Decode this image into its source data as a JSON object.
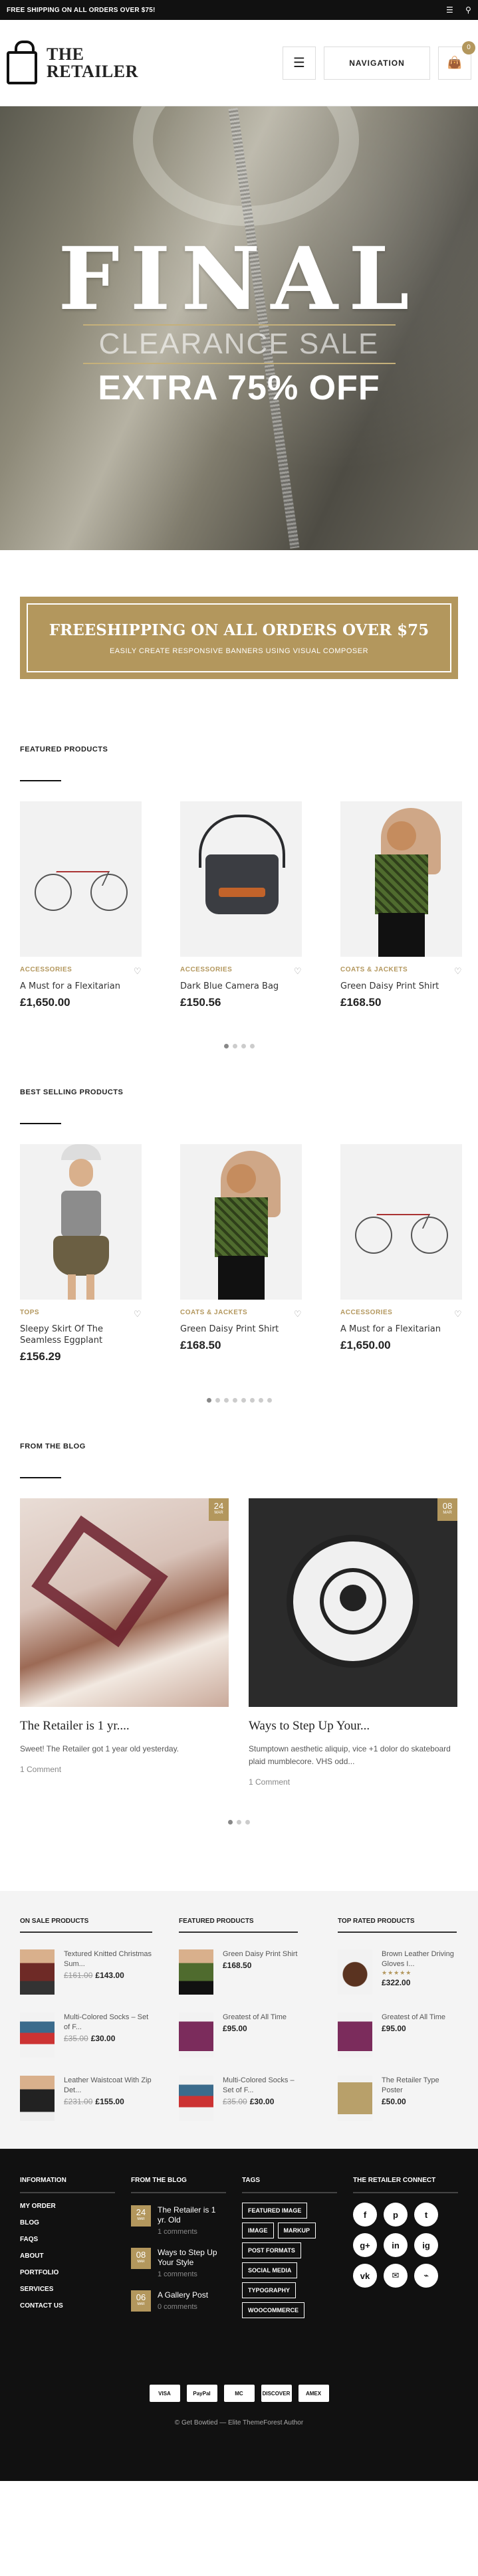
{
  "topbar": {
    "text": "FREE SHIPPING ON ALL ORDERS OVER $75!",
    "icons": [
      "menu-icon",
      "search-icon"
    ]
  },
  "header": {
    "logo_line1": "THE",
    "logo_line2": "RETAILER",
    "nav_label": "NAVIGATION",
    "cart_count": "0"
  },
  "hero": {
    "line1": "FINAL",
    "line2": "CLEARANCE SALE",
    "line3": "EXTRA 75% OFF"
  },
  "banner": {
    "title": "FREESHIPPING ON ALL ORDERS OVER $75",
    "subtitle": "EASILY CREATE RESPONSIVE BANNERS USING VISUAL COMPOSER"
  },
  "featured": {
    "title": "FEATURED PRODUCTS",
    "items": [
      {
        "category": "ACCESSORIES",
        "name": "A Must for a Flexitarian",
        "price": "£1,650.00"
      },
      {
        "category": "ACCESSORIES",
        "name": "Dark Blue Camera Bag",
        "price": "£150.56"
      },
      {
        "category": "COATS & JACKETS",
        "name": "Green Daisy Print Shirt",
        "price": "£168.50"
      }
    ]
  },
  "bestselling": {
    "title": "BEST SELLING PRODUCTS",
    "items": [
      {
        "category": "TOPS",
        "name": "Sleepy Skirt Of The Seamless Eggplant",
        "price": "£156.29"
      },
      {
        "category": "COATS & JACKETS",
        "name": "Green Daisy Print Shirt",
        "price": "£168.50"
      },
      {
        "category": "ACCESSORIES",
        "name": "A Must for a Flexitarian",
        "price": "£1,650.00"
      }
    ]
  },
  "blog": {
    "title": "FROM THE BLOG",
    "posts": [
      {
        "day": "24",
        "month": "MAR",
        "title": "The Retailer is 1 yr....",
        "excerpt": "Sweet! The Retailer got 1 year old yesterday.",
        "comments": "1 Comment"
      },
      {
        "day": "08",
        "month": "MAR",
        "title": "Ways to Step Up Your...",
        "excerpt": "Stumptown aesthetic aliquip, vice +1 dolor do skateboard plaid mumblecore. VHS odd...",
        "comments": "1 Comment"
      }
    ]
  },
  "lists": {
    "on_sale": {
      "title": "ON SALE PRODUCTS",
      "items": [
        {
          "name": "Textured Knitted Christmas Sum...",
          "old": "£161.00",
          "price": "£143.00"
        },
        {
          "name": "Multi-Colored Socks – Set of F...",
          "old": "£35.00",
          "price": "£30.00"
        },
        {
          "name": "Leather Waistcoat With Zip Det...",
          "old": "£231.00",
          "price": "£155.00"
        }
      ]
    },
    "featured": {
      "title": "FEATURED PRODUCTS",
      "items": [
        {
          "name": "Green Daisy Print Shirt",
          "old": "",
          "price": "£168.50"
        },
        {
          "name": "Greatest of All Time",
          "old": "",
          "price": "£95.00"
        },
        {
          "name": "Multi-Colored Socks – Set of F...",
          "old": "£35.00",
          "price": "£30.00"
        }
      ]
    },
    "top_rated": {
      "title": "TOP RATED PRODUCTS",
      "items": [
        {
          "name": "Brown Leather Driving Gloves I...",
          "old": "",
          "price": "£322.00",
          "rating": "★★★★★"
        },
        {
          "name": "Greatest of All Time",
          "old": "",
          "price": "£95.00"
        },
        {
          "name": "The Retailer Type Poster",
          "old": "",
          "price": "£50.00"
        }
      ]
    }
  },
  "footer": {
    "information": {
      "title": "INFORMATION",
      "links": [
        "MY ORDER",
        "BLOG",
        "FAQS",
        "ABOUT",
        "PORTFOLIO",
        "SERVICES",
        "CONTACT US"
      ]
    },
    "blog": {
      "title": "FROM THE BLOG",
      "posts": [
        {
          "day": "24",
          "month": "MAR",
          "title": "The Retailer is 1 yr. Old",
          "comments": "1 comments"
        },
        {
          "day": "08",
          "month": "MAR",
          "title": "Ways to Step Up Your Style",
          "comments": "1 comments"
        },
        {
          "day": "06",
          "month": "MAR",
          "title": "A Gallery Post",
          "comments": "0 comments"
        }
      ]
    },
    "tags": {
      "title": "TAGS",
      "items": [
        "FEATURED IMAGE",
        "IMAGE",
        "MARKUP",
        "POST FORMATS",
        "SOCIAL MEDIA",
        "TYPOGRAPHY",
        "WOOCOMMERCE"
      ]
    },
    "connect": {
      "title": "THE RETAILER CONNECT",
      "icons": [
        "f",
        "p",
        "t",
        "g+",
        "in",
        "ig",
        "vk",
        "✉",
        "⌁"
      ]
    },
    "payments": [
      "VISA",
      "PayPal",
      "MC",
      "DISCOVER",
      "AMEX"
    ],
    "copyright": "© Get Bowtied — Elite ThemeForest Author"
  }
}
